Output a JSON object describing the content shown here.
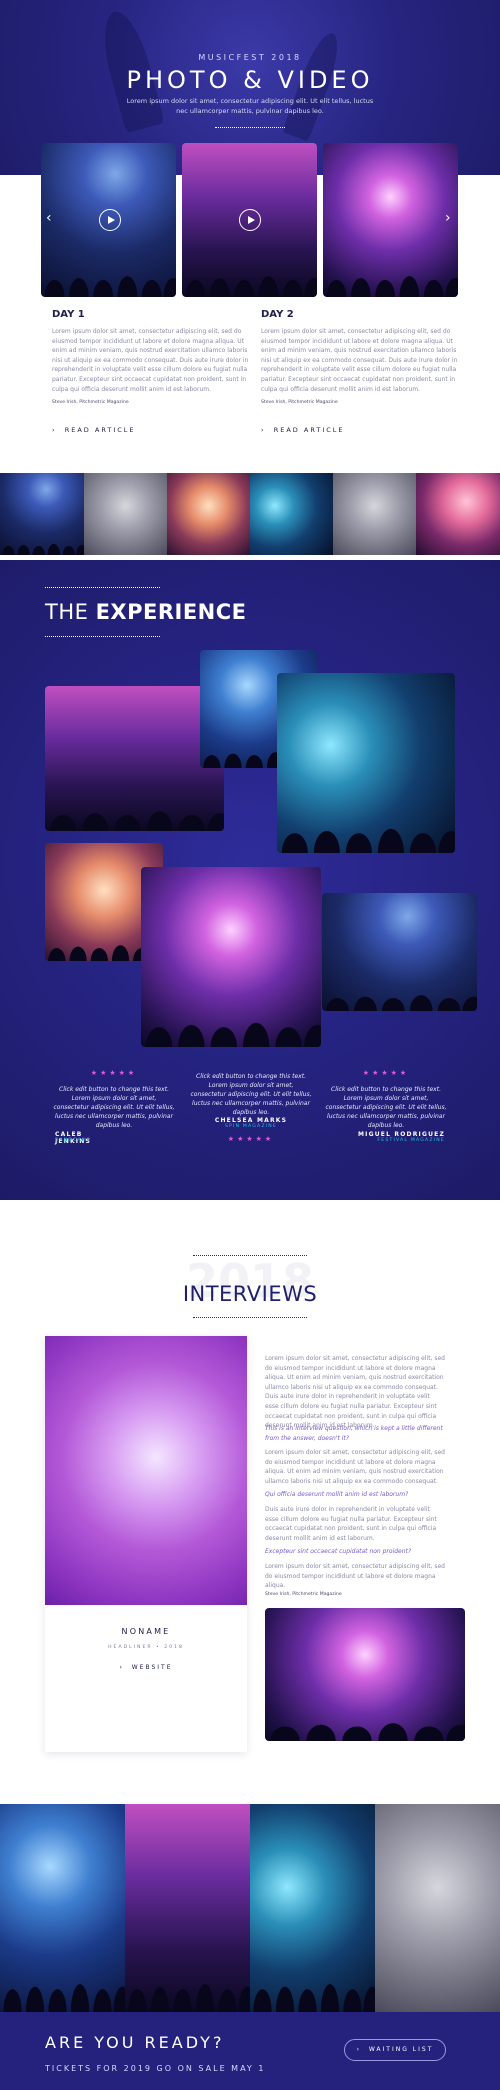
{
  "hero": {
    "eyebrow": "MUSICFEST 2018",
    "title": "PHOTO & VIDEO",
    "subtitle": "Lorem ipsum dolor sit amet, consectetur adipiscing elit. Ut elit tellus, luctus nec ullamcorper mattis, pulvinar dapibus leo."
  },
  "carousel": {
    "prev_icon": "chevron-left-icon",
    "next_icon": "chevron-right-icon",
    "play_icon": "play-icon"
  },
  "days": [
    {
      "title": "DAY 1",
      "body": "Lorem ipsum dolor sit amet, consectetur adipiscing elit, sed do eiusmod tempor incididunt ut labore et dolore magna aliqua. Ut enim ad minim veniam, quis nostrud exercitation ullamco laboris nisi ut aliquip ex ea commodo consequat. Duis aute irure dolor in reprehenderit in voluptate velit esse cillum dolore eu fugiat nulla pariatur. Excepteur sint occaecat cupidatat non proident, sunt in culpa qui officia deserunt mollit anim id est laborum.",
      "credit": "Steve Irish, Pitchmetric Magazine",
      "link": "READ ARTICLE"
    },
    {
      "title": "DAY 2",
      "body": "Lorem ipsum dolor sit amet, consectetur adipiscing elit, sed do eiusmod tempor incididunt ut labore et dolore magna aliqua. Ut enim ad minim veniam, quis nostrud exercitation ullamco laboris nisi ut aliquip ex ea commodo consequat. Duis aute irure dolor in reprehenderit in voluptate velit esse cillum dolore eu fugiat nulla pariatur. Excepteur sint occaecat cupidatat non proident, sunt in culpa qui officia deserunt mollit anim id est laborum.",
      "credit": "Steve Irish, Pitchmetric Magazine",
      "link": "READ ARTICLE"
    }
  ],
  "experience": {
    "title_light": "THE",
    "title_bold": "EXPERIENCE",
    "testimonials": [
      {
        "stars": "★★★★★",
        "quote": "Click edit button to change this text. Lorem ipsum dolor sit amet, consectetur adipiscing elit. Ut elit tellus, luctus nec ullamcorper mattis, pulvinar dapibus leo.",
        "name": "CALEB JENKINS",
        "role": "BANDCAMP"
      },
      {
        "stars": "★★★★★",
        "quote": "Click edit button to change this text. Lorem ipsum dolor sit amet, consectetur adipiscing elit. Ut elit tellus, luctus nec ullamcorper mattis, pulvinar dapibus leo.",
        "name": "CHELSEA MARKS",
        "role": "SPIN MAGAZINE"
      },
      {
        "stars": "★★★★★",
        "quote": "Click edit button to change this text. Lorem ipsum dolor sit amet, consectetur adipiscing elit. Ut elit tellus, luctus nec ullamcorper mattis, pulvinar dapibus leo.",
        "name": "MIGUEL RODRIGUEZ",
        "role": "FESTIVAL MAGAZINE"
      }
    ]
  },
  "interviews": {
    "bg_text": "2018",
    "title": "INTERVIEWS",
    "name": "NONAME",
    "name_sub": "HEADLINER • 2018",
    "website": "WEBSITE",
    "p1": "Lorem ipsum dolor sit amet, consectetur adipiscing elit, sed do eiusmod tempor incididunt ut labore et dolore magna aliqua. Ut enim ad minim veniam, quis nostrud exercitation ullamco laboris nisi ut aliquip ex ea commodo consequat. Duis aute irure dolor in reprehenderit in voluptate velit esse cillum dolore eu fugiat nulla pariatur. Excepteur sint occaecat cupidatat non proident, sunt in culpa qui officia deserunt mollit anim id est laborum.",
    "q1": "This is an interview question, which is kept a little different from the answer, doesn't it?",
    "p2": "Lorem ipsum dolor sit amet, consectetur adipiscing elit, sed do eiusmod tempor incididunt ut labore et dolore magna aliqua. Ut enim ad minim veniam, quis nostrud exercitation ullamco laboris nisi ut aliquip ex ea commodo consequat.",
    "q2": "Qui officia deserunt mollit anim id est laborum?",
    "p3": "Duis aute irure dolor in reprehenderit in voluptate velit esse cillum dolore eu fugiat nulla pariatur. Excepteur sint occaecat cupidatat non proident, sunt in culpa qui officia deserunt mollit anim id est laborum.",
    "q3": "Excepteur sint occaecat cupidatat non proident?",
    "p4": "Lorem ipsum dolor sit amet, consectetur adipiscing elit, sed do eiusmod tempor incididunt ut labore et dolore magna aliqua.",
    "credit": "Steve Irish, Pitchmetric Magazine"
  },
  "footer": {
    "title": "ARE YOU READY?",
    "subtitle": "TICKETS FOR 2019 GO ON SALE MAY 1",
    "button": "WAITING LIST",
    "button_icon": "chevron-right-icon"
  }
}
